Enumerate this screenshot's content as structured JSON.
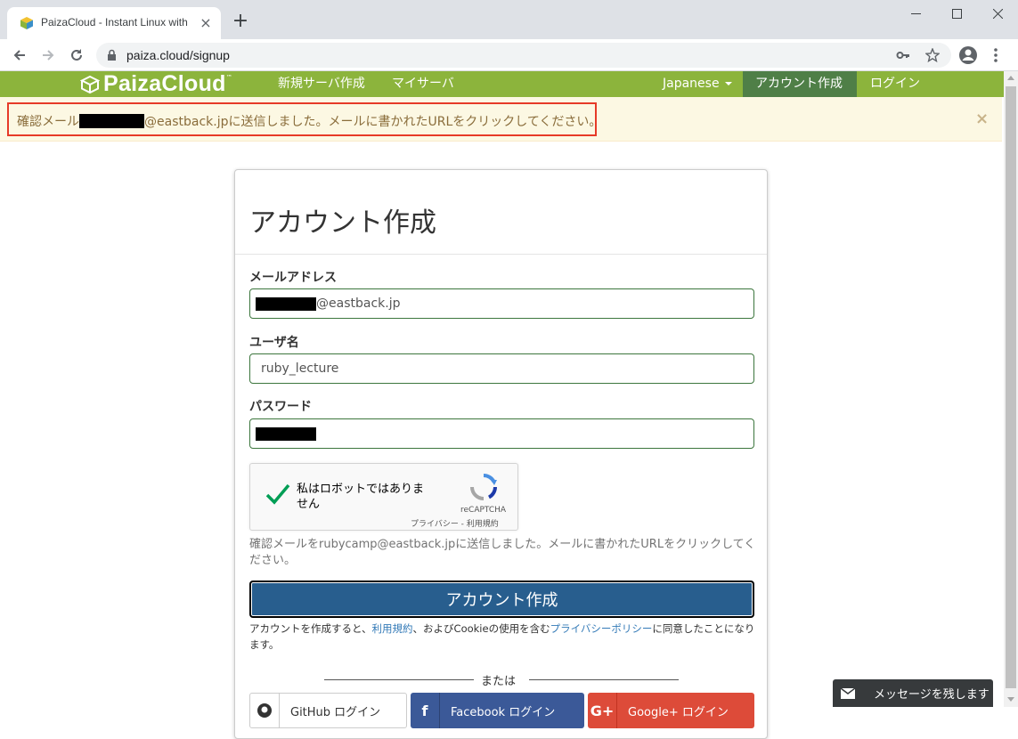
{
  "browser": {
    "tab_title": "PaizaCloud - Instant Linux with Web",
    "url": "paiza.cloud/signup",
    "new_tab": "+",
    "tab_close": "×"
  },
  "site_nav": {
    "logo": "PaizaCloud",
    "logo_tm": "™",
    "links": [
      "新規サーバ作成",
      "マイサーバ"
    ],
    "language": "Japanese",
    "signup": "アカウント作成",
    "login": "ログイン"
  },
  "alert": {
    "prefix": "確認メールを",
    "suffix": "@eastback.jpに送信しました。メールに書かれたURLをクリックしてください。",
    "close": "×"
  },
  "form": {
    "title": "アカウント作成",
    "email_label": "メールアドレス",
    "email_value_suffix": "@eastback.jp",
    "username_label": "ユーザ名",
    "username_value": "ruby_lecture",
    "password_label": "パスワード",
    "captcha_label": "私はロボットではありません",
    "captcha_brand": "reCAPTCHA",
    "captcha_links": "プライバシー - 利用規約",
    "help_text": "確認メールをrubycamp@eastback.jpに送信しました。メールに書かれたURLをクリックしてください。",
    "submit": "アカウント作成",
    "terms_prefix": "アカウントを作成すると、",
    "terms_link": "利用規約",
    "terms_middle": "、およびCookieの使用を含む",
    "privacy_link": "プライバシーポリシー",
    "terms_suffix": "に同意したことになります。",
    "or": "または",
    "github": "GitHub ログイン",
    "facebook": "Facebook ログイン",
    "google": "Google+ ログイン"
  },
  "chat": {
    "label": "メッセージを残します"
  },
  "colors": {
    "nav_green": "#8cb43c",
    "nav_active": "#4f7f47",
    "alert_bg": "#fcf8e3",
    "alert_text": "#8a6d3b",
    "submit_bg": "#285e8e",
    "facebook": "#3b5998",
    "google": "#dd4b39"
  }
}
